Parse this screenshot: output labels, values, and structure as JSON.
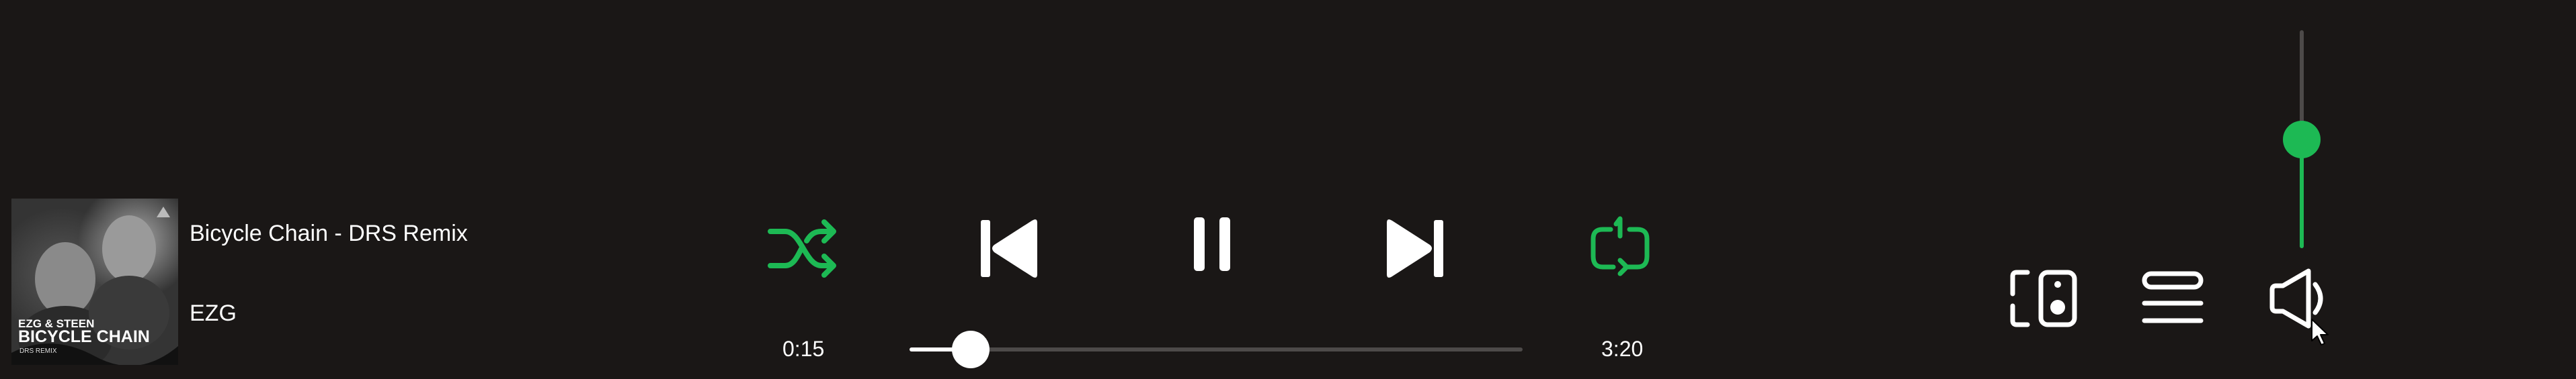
{
  "now_playing": {
    "title": "Bicycle Chain - DRS Remix",
    "artist": "EZG",
    "album_art_text_1": "EZG & STEEN",
    "album_art_text_2": "BICYCLE CHAIN",
    "album_art_text_3": "DRS REMIX"
  },
  "controls": {
    "shuffle_icon": "shuffle-icon",
    "previous_icon": "skip-back-icon",
    "pause_icon": "pause-icon",
    "next_icon": "skip-forward-icon",
    "repeat_icon": "repeat-one-icon",
    "shuffle_active": true,
    "repeat_active": true
  },
  "progress": {
    "elapsed": "0:15",
    "total": "3:20",
    "fraction": 0.1
  },
  "right_controls": {
    "devices_icon": "speaker-devices-icon",
    "queue_icon": "queue-icon",
    "volume_icon": "volume-muted-icon"
  },
  "volume": {
    "fraction": 0.5
  },
  "colors": {
    "background": "#1a1716",
    "accent": "#1db954",
    "foreground": "#ffffff",
    "track": "#4d4a49"
  }
}
